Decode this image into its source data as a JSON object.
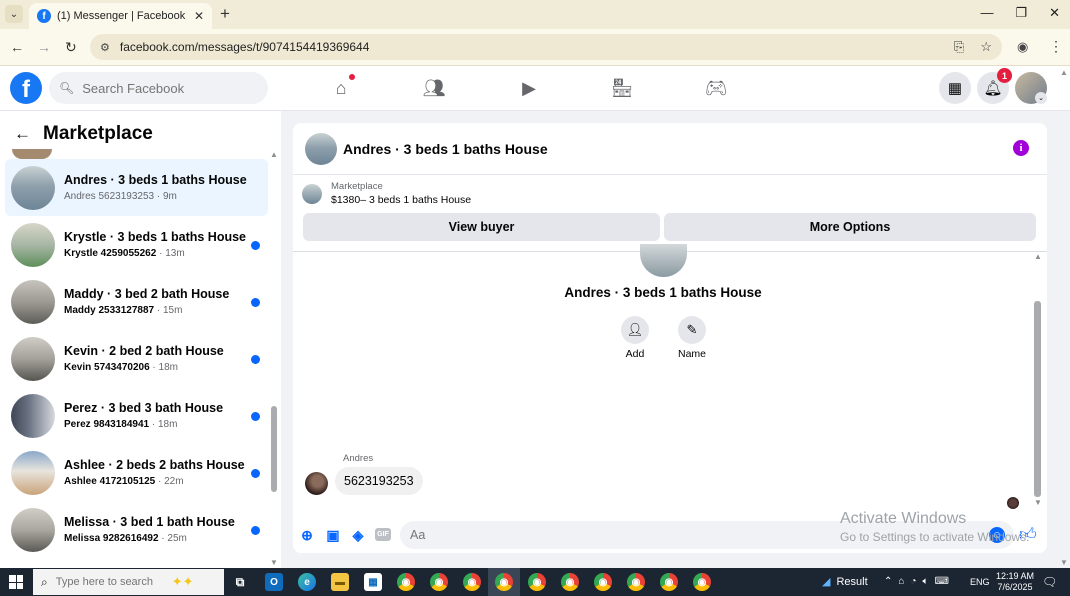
{
  "browser": {
    "tab_title": "(1) Messenger | Facebook",
    "url": "facebook.com/messages/t/9074154419369644"
  },
  "fb": {
    "search_placeholder": "Search Facebook",
    "notification_count": "1"
  },
  "sidebar": {
    "title": "Marketplace",
    "items": [
      {
        "name": "Andres · 3 beds 1 baths House",
        "sub": "Andres 5623193253 · 9m",
        "active": true,
        "unread": false,
        "colors": [
          "#6d8596",
          "#c9d2d3"
        ]
      },
      {
        "name": "Krystle · 3 beds 1 baths House",
        "sub_name": "Krystle 4259055262",
        "sub_time": " · 13m",
        "unread": true,
        "colors": [
          "#5e8f5a",
          "#d8d6c8"
        ]
      },
      {
        "name": "Maddy · 3 bed 2 bath House",
        "sub_name": "Maddy 2533127887",
        "sub_time": " · 15m",
        "unread": true,
        "colors": [
          "#9c9a93",
          "#5d5d58"
        ]
      },
      {
        "name": "Kevin · 2 bed 2 bath House",
        "sub_name": "Kevin 5743470206",
        "sub_time": " · 18m",
        "unread": true,
        "colors": [
          "#a3a19a",
          "#56554f"
        ]
      },
      {
        "name": "Perez · 3 bed 3 bath House",
        "sub_name": "Perez 9843184941",
        "sub_time": " · 18m",
        "unread": true,
        "colors": [
          "#6a7383",
          "#d6d9de"
        ]
      },
      {
        "name": "Ashlee · 2 beds 2 baths House",
        "sub_name": "Ashlee 4172105125",
        "sub_time": " · 22m",
        "unread": true,
        "colors": [
          "#8aa9c9",
          "#c9a37a"
        ]
      },
      {
        "name": "Melissa · 3 bed 1 bath House",
        "sub_name": "Melissa 9282616492",
        "sub_time": " · 25m",
        "unread": true,
        "colors": [
          "#a9a79f",
          "#5a5955"
        ]
      }
    ]
  },
  "chat": {
    "title": "Andres · 3 beds 1 baths House",
    "marketplace_label": "Marketplace",
    "listing": "$1380– 3 beds 1 baths House",
    "view_buyer": "View buyer",
    "more_options": "More Options",
    "conv_name": "Andres · 3 beds 1 baths House",
    "add_label": "Add",
    "name_label": "Name",
    "sender": "Andres",
    "message": "5623193253",
    "input_placeholder": "Aa",
    "gif_label": "GIF"
  },
  "watermark": {
    "line1": "Activate Windows",
    "line2": "Go to Settings to activate Windows."
  },
  "taskbar": {
    "search_placeholder": "Type here to search",
    "weather": "Result",
    "lang": "ENG",
    "time": "12:19 AM",
    "date": "7/6/2025"
  }
}
